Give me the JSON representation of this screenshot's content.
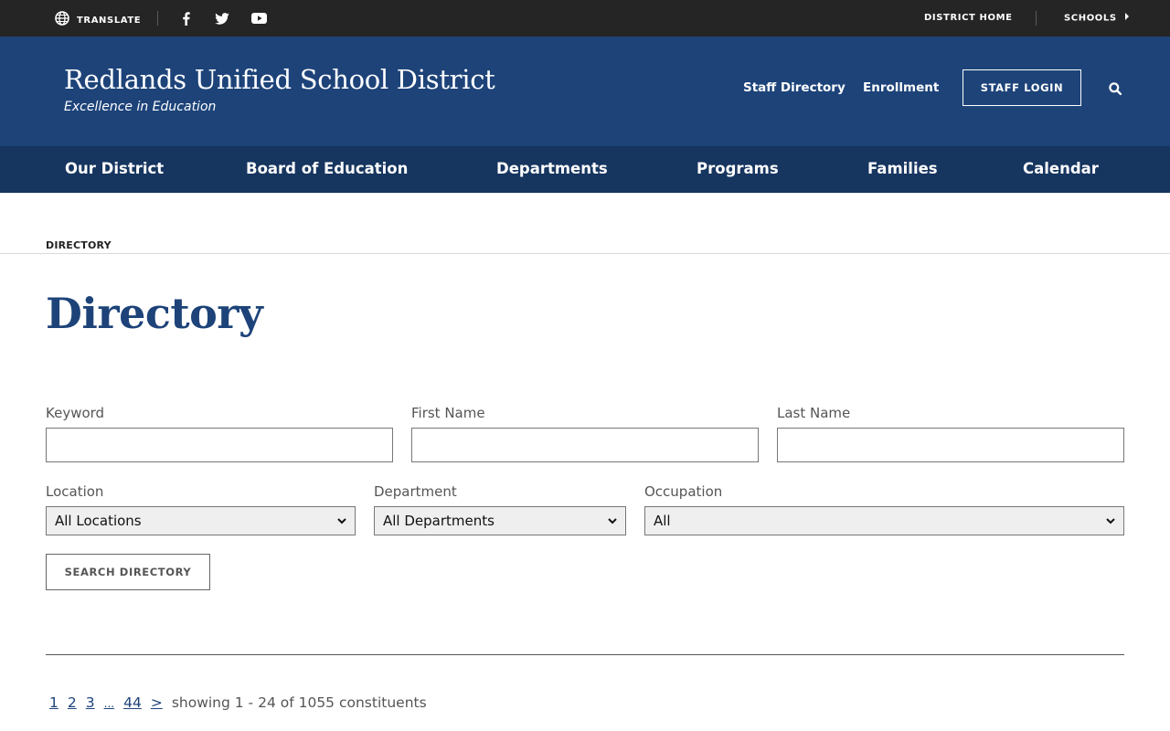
{
  "topbar": {
    "translate_label": "TRANSLATE",
    "district_home": "DISTRICT HOME",
    "schools": "SCHOOLS"
  },
  "header": {
    "title": "Redlands Unified School District",
    "tagline": "Excellence in Education",
    "staff_directory": "Staff Directory",
    "enrollment": "Enrollment",
    "staff_login": "STAFF LOGIN"
  },
  "nav": {
    "items": [
      "Our District",
      "Board of Education",
      "Departments",
      "Programs",
      "Families",
      "Calendar"
    ]
  },
  "breadcrumb": "DIRECTORY",
  "page_title": "Directory",
  "form": {
    "keyword_label": "Keyword",
    "keyword_value": "",
    "first_name_label": "First Name",
    "first_name_value": "",
    "last_name_label": "Last Name",
    "last_name_value": "",
    "location_label": "Location",
    "location_value": "All Locations",
    "department_label": "Department",
    "department_value": "All Departments",
    "occupation_label": "Occupation",
    "occupation_value": "All",
    "search_button": "SEARCH DIRECTORY"
  },
  "pagination": {
    "pages": [
      "1",
      "2",
      "3",
      "...",
      "44",
      ">"
    ],
    "showing": "showing 1 - 24 of 1055 constituents"
  },
  "colors": {
    "topbar": "#252525",
    "header": "#1d4379",
    "nav": "#16355f",
    "title": "#1d4379"
  }
}
